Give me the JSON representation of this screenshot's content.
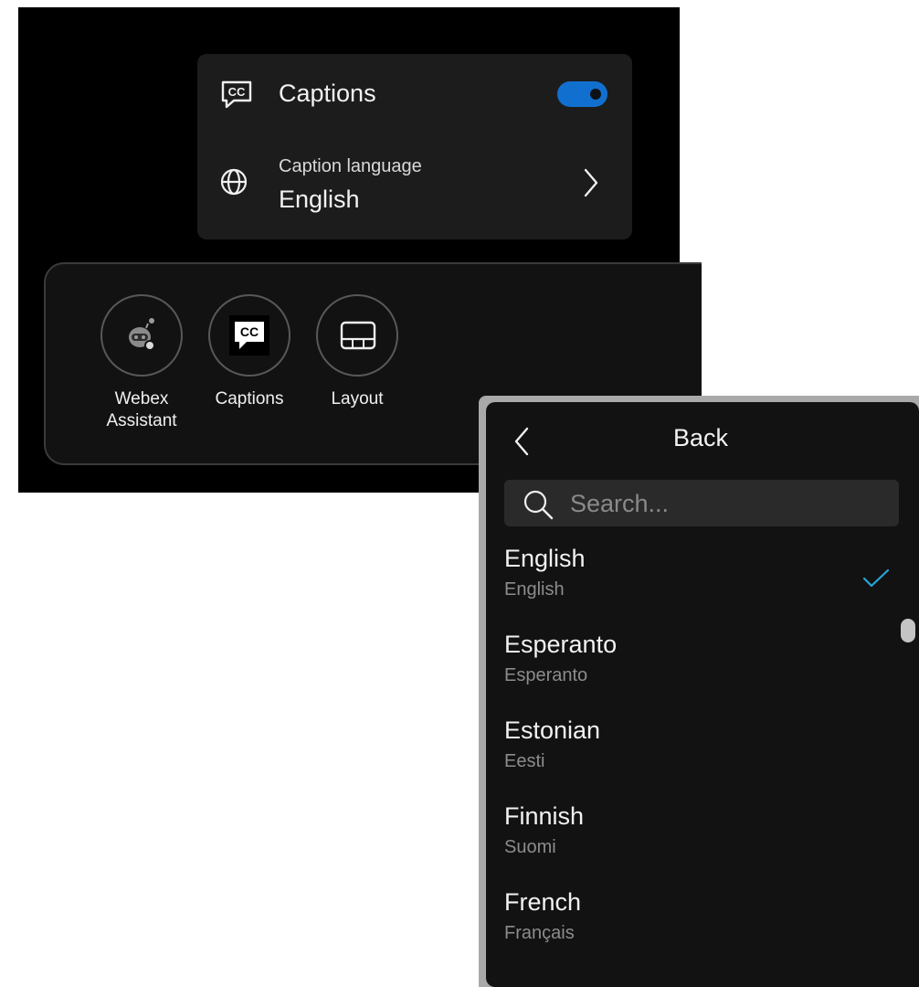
{
  "settings": {
    "captions_label": "Captions",
    "captions_toggle": "on",
    "caption_language_label": "Caption language",
    "caption_language_value": "English"
  },
  "dock": {
    "items": [
      {
        "line1": "Webex",
        "line2": "Assistant",
        "icon": "assistant-bot-icon"
      },
      {
        "line1": "Captions",
        "line2": "",
        "icon": "cc-icon"
      },
      {
        "line1": "Layout",
        "line2": "",
        "icon": "layout-icon"
      }
    ]
  },
  "language_panel": {
    "back_label": "Back",
    "search_placeholder": "Search...",
    "selected": "English",
    "items": [
      {
        "name": "English",
        "native": "English"
      },
      {
        "name": "Esperanto",
        "native": "Esperanto"
      },
      {
        "name": "Estonian",
        "native": "Eesti"
      },
      {
        "name": "Finnish",
        "native": "Suomi"
      },
      {
        "name": "French",
        "native": "Français"
      }
    ]
  },
  "colors": {
    "accent": "#1170cf",
    "check": "#27a4d8"
  }
}
